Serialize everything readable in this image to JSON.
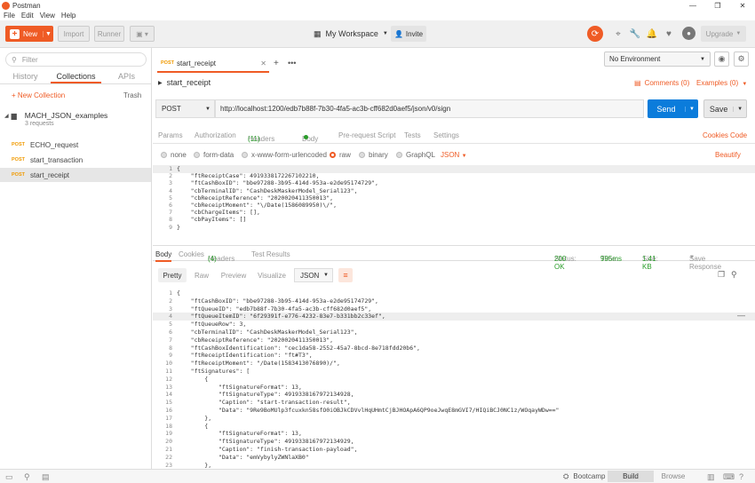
{
  "window": {
    "title": "Postman",
    "minimize": "—",
    "maximize": "❐",
    "close": "✕"
  },
  "menu": [
    "File",
    "Edit",
    "View",
    "Help"
  ],
  "toolbar": {
    "new_label": "New",
    "import_label": "Import",
    "runner_label": "Runner",
    "workspace_label": "My Workspace",
    "invite_label": "Invite",
    "upgrade_label": "Upgrade"
  },
  "sidebar": {
    "filter_placeholder": "Filter",
    "tabs": [
      "History",
      "Collections",
      "APIs"
    ],
    "new_collection_label": "+ New Collection",
    "trash_label": "Trash",
    "collection": {
      "name": "MACH_JSON_examples",
      "count": "3 requests"
    },
    "requests": [
      {
        "method": "POST",
        "name": "ECHO_request"
      },
      {
        "method": "POST",
        "name": "start_transaction"
      },
      {
        "method": "POST",
        "name": "start_receipt"
      }
    ]
  },
  "main": {
    "tab": {
      "method": "POST",
      "name": "start_receipt"
    },
    "environment": "No Environment",
    "request_name": "start_receipt",
    "comments_label": "Comments (0)",
    "examples_label": "Examples (0)",
    "method": "POST",
    "url": "http://localhost:1200/edb7b88f-7b30-4fa5-ac3b-cff682d0aef5/json/v0/sign",
    "send_label": "Send",
    "save_label": "Save",
    "subtabs": {
      "params": "Params",
      "authorization": "Authorization",
      "headers": "Headers",
      "headers_count": "(11)",
      "body": "Body",
      "prerequest": "Pre-request Script",
      "tests": "Tests",
      "settings": "Settings",
      "cookies": "Cookies",
      "code": "Code"
    },
    "body_options": [
      "none",
      "form-data",
      "x-www-form-urlencoded",
      "raw",
      "binary",
      "GraphQL"
    ],
    "body_format": "JSON",
    "beautify_label": "Beautify",
    "request_body": [
      "{",
      "    \"ftReceiptCase\": 4919338172267102210,",
      "    \"ftCashBoxID\": \"bbe97288-3b95-414d-953a-e2de95174729\",",
      "    \"cbTerminalID\": \"CashDeskMaskerModel_Serial123\",",
      "    \"cbReceiptReference\": \"2020020411350013\",",
      "    \"cbReceiptMoment\": \"\\/Date(1586089950)\\/\",",
      "    \"cbChargeItems\": [],",
      "    \"cbPayItems\": []",
      "}"
    ],
    "response": {
      "tabs": {
        "body": "Body",
        "cookies": "Cookies",
        "headers": "Headers",
        "headers_count": "(4)",
        "test_results": "Test Results"
      },
      "status_label": "Status:",
      "status_value": "200 OK",
      "time_label": "Time:",
      "time_value": "995ms",
      "size_label": "Size:",
      "size_value": "1.41 KB",
      "save_response_label": "Save Response",
      "view_modes": [
        "Pretty",
        "Raw",
        "Preview",
        "Visualize"
      ],
      "format": "JSON",
      "lines": [
        "{",
        "    \"ftCashBoxID\": \"bbe97288-3b95-414d-953a-e2de95174729\",",
        "    \"ftQueueID\": \"edb7b88f-7b30-4fa5-ac3b-cff682d0aef5\",",
        "    \"ftQueueItemID\": \"6f29391f-e776-4232-83e7-b331bb2c33ef\",",
        "    \"ftQueueRow\": 3,",
        "    \"cbTerminalID\": \"CashDeskMaskerModel_Serial123\",",
        "    \"cbReceiptReference\": \"2020020411350013\",",
        "    \"ftCashBoxIdentification\": \"cec1da58-2552-45a7-8bcd-8e718fdd20b6\",",
        "    \"ftReceiptIdentification\": \"ft#T3\",",
        "    \"ftReceiptMoment\": \"/Date(1583413076890)/\",",
        "    \"ftSignatures\": [",
        "        {",
        "            \"ftSignatureFormat\": 13,",
        "            \"ftSignatureType\": 4919338167972134928,",
        "            \"Caption\": \"start-transaction-result\",",
        "            \"Data\": \"9Re9BoMUlp3fcuxkn58sfO0iOBJkCDVvlHqUHmtCjBJHOApA6QP9oeJwqE8mGVI7/HIQiBCJ0NC1z/WOqayWDw==\"",
        "        },",
        "        {",
        "            \"ftSignatureFormat\": 13,",
        "            \"ftSignatureType\": 4919338167972134929,",
        "            \"Caption\": \"finish-transaction-payload\",",
        "            \"Data\": \"emVybylyZWNlaXB0\"",
        "        },"
      ]
    }
  },
  "statusbar": {
    "bootcamp_label": "Bootcamp",
    "build_label": "Build",
    "browse_label": "Browse"
  },
  "colors": {
    "accent": "#ef5b25",
    "send": "#0b7cdb",
    "status_ok": "#2a9d2a"
  }
}
